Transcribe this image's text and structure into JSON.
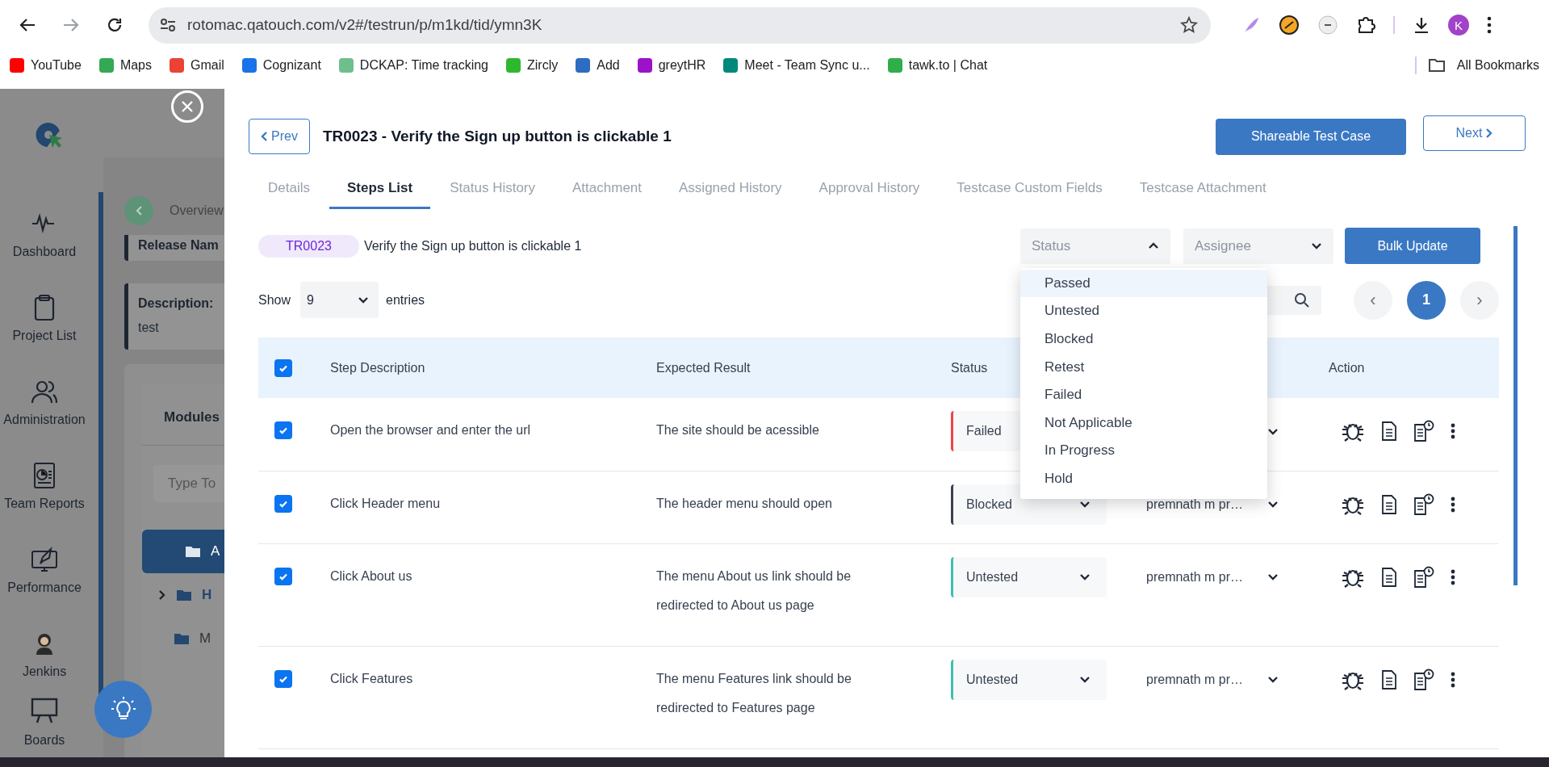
{
  "browser": {
    "url": "rotomac.qatouch.com/v2#/testrun/p/m1kd/tid/ymn3K",
    "profile_initial": "K",
    "bookmarks": [
      {
        "label": "YouTube",
        "color": "#ff0000"
      },
      {
        "label": "Maps",
        "color": "#34a853"
      },
      {
        "label": "Gmail",
        "color": "#ea4335"
      },
      {
        "label": "Cognizant",
        "color": "#1a73e8"
      },
      {
        "label": "DCKAP: Time tracking",
        "color": "#6fbf8e"
      },
      {
        "label": "Zircly",
        "color": "#2eb82e"
      },
      {
        "label": "Add",
        "color": "#2d6cc0"
      },
      {
        "label": "greytHR",
        "color": "#9b12c9"
      },
      {
        "label": "Meet - Team Sync u...",
        "color": "#00897b"
      },
      {
        "label": "tawk.to | Chat",
        "color": "#2fae4a"
      }
    ],
    "all_bookmarks": "All Bookmarks"
  },
  "app": {
    "sidebar": [
      {
        "label": "Dashboard",
        "kind": "pulse"
      },
      {
        "label": "Project List",
        "kind": "clipboard"
      },
      {
        "label": "Administration",
        "kind": "users"
      },
      {
        "label": "Team Reports",
        "kind": "report"
      },
      {
        "label": "Performance",
        "kind": "rocket"
      },
      {
        "label": "Jenkins",
        "kind": "butler"
      },
      {
        "label": "Boards",
        "kind": "board"
      }
    ],
    "breadcrumb": "Overview",
    "release_label": "Release Nam",
    "description_label": "Description:",
    "description_value": "test",
    "modules_title": "Modules",
    "module_search_placeholder": "Type To",
    "tree": [
      {
        "label": "A",
        "selected": true,
        "expandable": false
      },
      {
        "label": "H",
        "selected": false,
        "expandable": true
      },
      {
        "label": "M",
        "selected": false,
        "expandable": false
      }
    ]
  },
  "modal": {
    "prev": "Prev",
    "title": "TR0023 - Verify the Sign up button is clickable 1",
    "share": "Shareable Test Case",
    "next": "Next",
    "tabs": [
      {
        "label": "Details",
        "selected": false
      },
      {
        "label": "Steps List",
        "selected": true
      },
      {
        "label": "Status History",
        "selected": false
      },
      {
        "label": "Attachment",
        "selected": false
      },
      {
        "label": "Assigned History",
        "selected": false
      },
      {
        "label": "Approval History",
        "selected": false
      },
      {
        "label": "Testcase Custom Fields",
        "selected": false
      },
      {
        "label": "Testcase Attachment",
        "selected": false
      }
    ],
    "case_id": "TR0023",
    "case_title": "Verify the Sign up button is clickable 1",
    "status_filter": {
      "placeholder": "Status",
      "expanded": true,
      "options": [
        {
          "label": "Passed",
          "selected": true
        },
        {
          "label": "Untested",
          "selected": false
        },
        {
          "label": "Blocked",
          "selected": false
        },
        {
          "label": "Retest",
          "selected": false
        },
        {
          "label": "Failed",
          "selected": false
        },
        {
          "label": "Not Applicable",
          "selected": false
        },
        {
          "label": "In Progress",
          "selected": false
        },
        {
          "label": "Hold",
          "selected": false
        }
      ]
    },
    "assignee_filter": {
      "placeholder": "Assignee"
    },
    "bulk_update": "Bulk Update",
    "show_label": "Show",
    "entries_value": "9",
    "entries_label": "entries",
    "pagination": {
      "prev": "‹",
      "next": "›",
      "pages": [
        {
          "label": "1",
          "selected": true
        }
      ]
    },
    "table": {
      "all_checked": true,
      "columns": [
        "Step Description",
        "Expected Result",
        "Status",
        "Action"
      ],
      "rows": [
        {
          "checked": true,
          "step": "Open the browser and enter the url",
          "expected": "The site should be acessible",
          "status": "Failed",
          "color": "#ef4444"
        },
        {
          "checked": true,
          "step": "Click Header menu",
          "expected": "The header menu should open",
          "status": "Blocked",
          "color": "#3b4050",
          "assignee": "premnath m pr…"
        },
        {
          "checked": true,
          "step": "Click About us",
          "expected": "The menu About us link should be redirected to About us page",
          "status": "Untested",
          "color": "#3ebfae",
          "assignee": "premnath m pr…"
        },
        {
          "checked": true,
          "step": "Click Features",
          "expected": "The menu Features link should be redirected to Features page",
          "status": "Untested",
          "color": "#3ebfae",
          "assignee": "premnath m pr…"
        }
      ]
    }
  }
}
